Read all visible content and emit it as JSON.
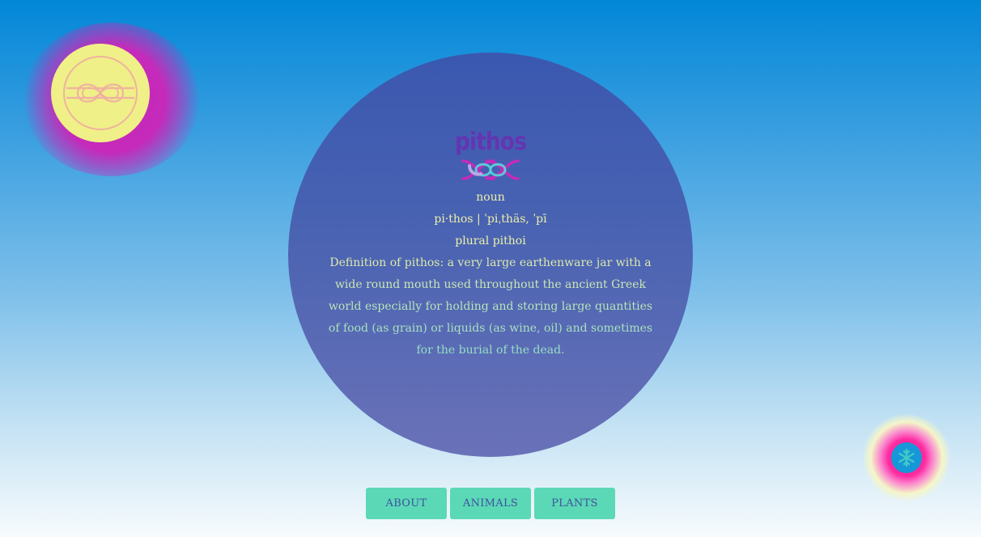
{
  "logo": {
    "word": "pithos"
  },
  "entry": {
    "part_of_speech": "noun",
    "pronunciation": "pi·thos | ˈpiˌthäs, ˈpī",
    "plural": "plural pithoi",
    "definition": "Definition of pithos: a very large earthenware jar with a wide round mouth used throughout the ancient Greek world especially for holding and storing large quantities of food (as grain) or liquids (as wine, oil) and sometimes for the burial of the dead."
  },
  "nav": {
    "items": [
      {
        "label": "ABOUT"
      },
      {
        "label": "ANIMALS"
      },
      {
        "label": "PLANTS"
      }
    ]
  },
  "colors": {
    "circle": "#4a63b2",
    "button": "#5bd9b6",
    "button_text": "#3f4fa0",
    "text": "#ecf0a8",
    "logo": "#6435b2"
  },
  "icons": {
    "corner": "knot-icon",
    "bottom": "snowflake-icon"
  }
}
